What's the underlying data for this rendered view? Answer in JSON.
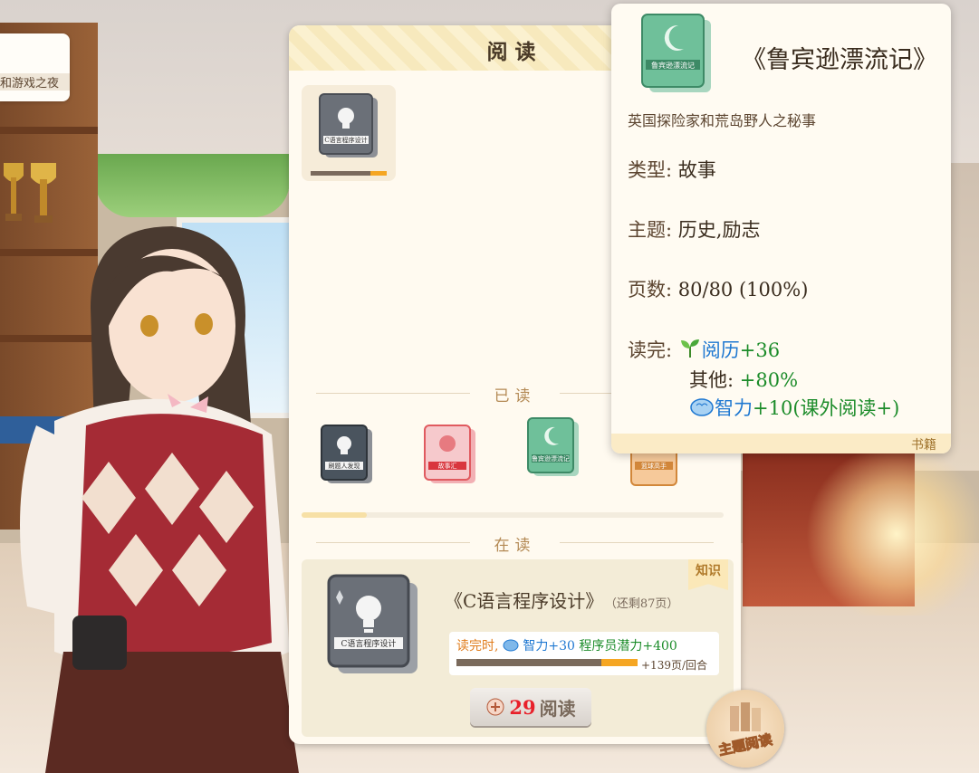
{
  "left_card": {
    "label": "和游戏之夜"
  },
  "panel": {
    "title": "阅读",
    "section_read": "已读",
    "section_reading": "在读",
    "slot_book": {
      "cover_text": "C语言程序设计",
      "icon": "lightbulb-icon"
    },
    "read_books": [
      {
        "cover_text": "刷题人发现",
        "color": "#4a545e",
        "icon": "lightbulb-icon"
      },
      {
        "cover_text": "故事汇",
        "color": "#e05a5f",
        "icon": "face-icon"
      },
      {
        "cover_text": "鲁宾逊漂流记",
        "color": "#5fb08a",
        "icon": "moon-icon"
      },
      {
        "cover_text": "篮球高手",
        "color": "#e08a3a",
        "icon": "ball-icon"
      }
    ],
    "current": {
      "tag": "知识",
      "title": "《C语言程序设计》",
      "remaining": "（还剩87页）",
      "cover_text": "C语言程序设计",
      "reward_prefix": "读完时,",
      "reward_stat": "智力+30",
      "reward_extra": "程序员潜力+400",
      "progress_fraction": 0.2,
      "rate": "+139页/回合",
      "cost": "29",
      "button_label": "阅读"
    }
  },
  "tooltip": {
    "title": "《鲁宾逊漂流记》",
    "cover_text": "鲁宾逊漂流记",
    "description": "英国探险家和荒岛野人之秘事",
    "type_label": "类型:",
    "type_value": "故事",
    "theme_label": "主题:",
    "theme_value": "历史,励志",
    "pages_label": "页数:",
    "pages_value": "80/80 (100%)",
    "finish_label": "读完:",
    "reward_exp": "阅历+36",
    "reward_other_label": "其他:",
    "reward_other_value": "+80%",
    "reward_int": "智力+10(课外阅读+)",
    "footer": "书籍"
  },
  "theme_badge": {
    "label": "主题阅读"
  }
}
